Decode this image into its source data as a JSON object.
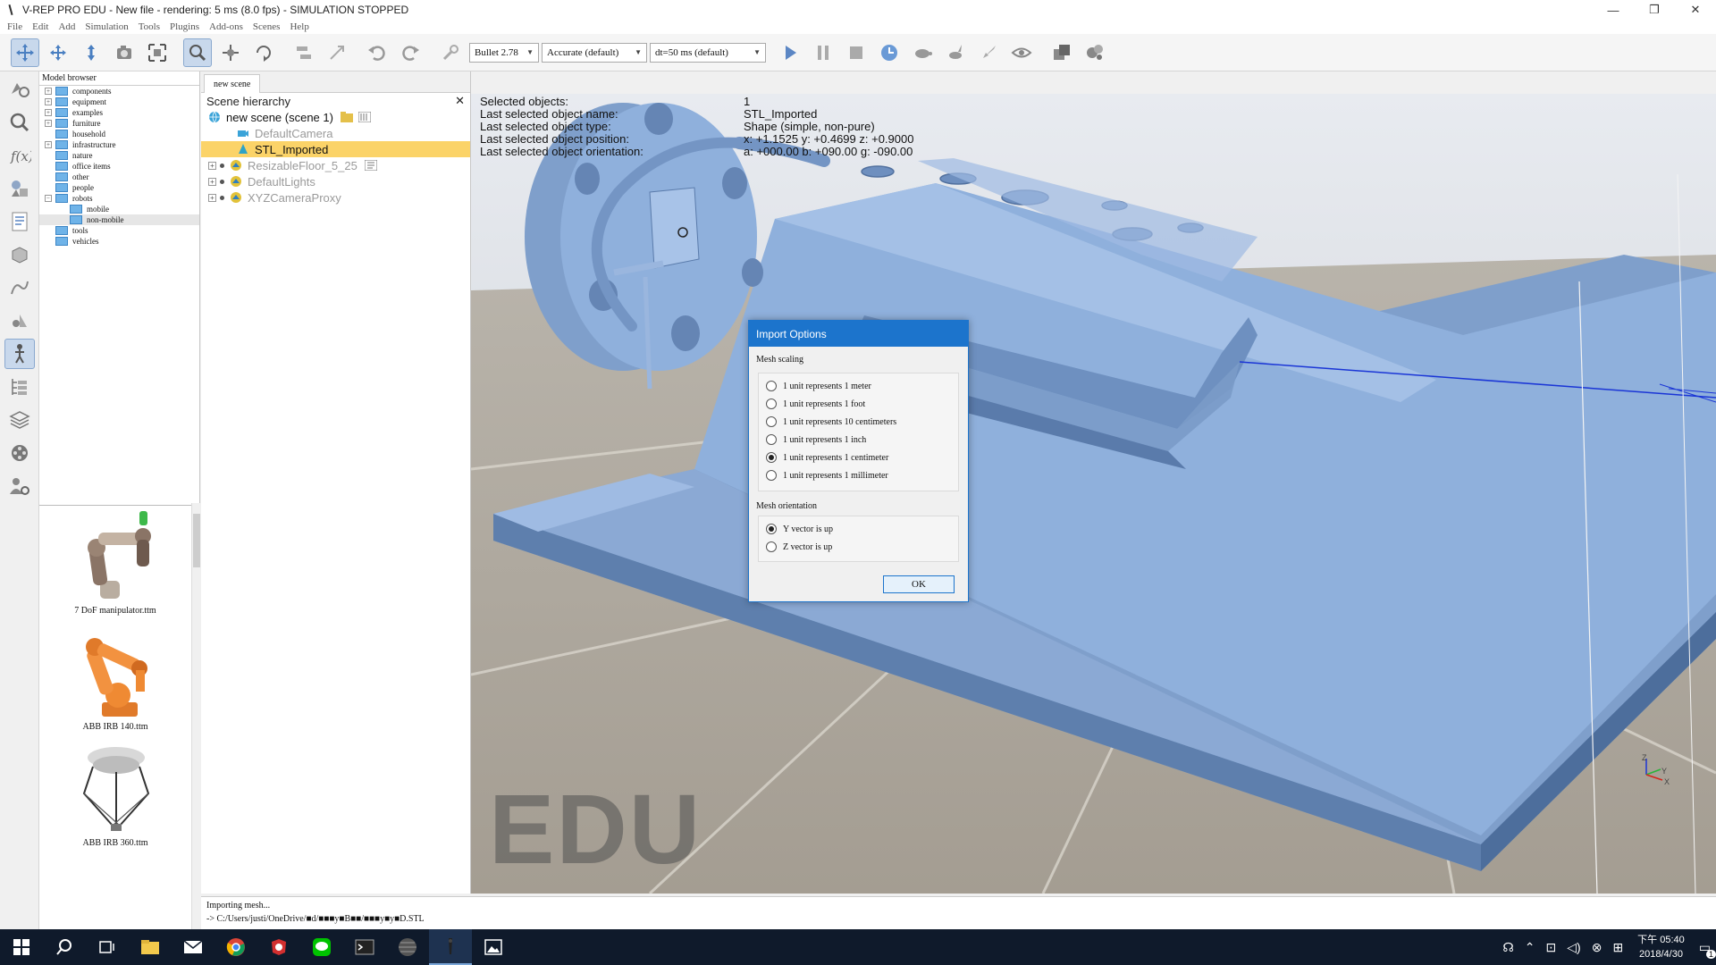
{
  "window": {
    "title": "V-REP PRO EDU - New file - rendering: 5 ms (8.0 fps) - SIMULATION STOPPED",
    "minimize": "—",
    "restore": "❐",
    "close": "✕"
  },
  "menu": [
    "File",
    "Edit",
    "Add",
    "Simulation",
    "Tools",
    "Plugins",
    "Add-ons",
    "Scenes",
    "Help"
  ],
  "toolbar": {
    "engine": "Bullet 2.78",
    "accuracy": "Accurate (default)",
    "timestep": "dt=50 ms (default)"
  },
  "model_browser": {
    "title": "Model browser",
    "tree": [
      {
        "label": "components",
        "expander": "+",
        "depth": 0
      },
      {
        "label": "equipment",
        "expander": "+",
        "depth": 0
      },
      {
        "label": "examples",
        "expander": "+",
        "depth": 0
      },
      {
        "label": "furniture",
        "expander": "+",
        "depth": 0
      },
      {
        "label": "household",
        "expander": "",
        "depth": 0
      },
      {
        "label": "infrastructure",
        "expander": "+",
        "depth": 0
      },
      {
        "label": "nature",
        "expander": "",
        "depth": 0
      },
      {
        "label": "office items",
        "expander": "",
        "depth": 0
      },
      {
        "label": "other",
        "expander": "",
        "depth": 0
      },
      {
        "label": "people",
        "expander": "",
        "depth": 0
      },
      {
        "label": "robots",
        "expander": "−",
        "depth": 0
      },
      {
        "label": "mobile",
        "expander": "",
        "depth": 1
      },
      {
        "label": "non-mobile",
        "expander": "",
        "depth": 1,
        "selected": true
      },
      {
        "label": "tools",
        "expander": "",
        "depth": 0
      },
      {
        "label": "vehicles",
        "expander": "",
        "depth": 0
      }
    ],
    "thumbnails": [
      {
        "label": "7 DoF manipulator.ttm"
      },
      {
        "label": "ABB IRB 140.ttm"
      },
      {
        "label": "ABB IRB 360.ttm"
      }
    ]
  },
  "scene": {
    "tab": "new scene",
    "hierarchy_title": "Scene hierarchy",
    "items": [
      {
        "label": "new scene (scene 1)",
        "kind": "root"
      },
      {
        "label": "DefaultCamera",
        "kind": "camera",
        "dim": true
      },
      {
        "label": "STL_Imported",
        "kind": "shape",
        "selected": true
      },
      {
        "label": "ResizableFloor_5_25",
        "kind": "floor",
        "dim": true
      },
      {
        "label": "DefaultLights",
        "kind": "lights",
        "dim": true
      },
      {
        "label": "XYZCameraProxy",
        "kind": "proxy",
        "dim": true
      }
    ]
  },
  "viewport": {
    "info": [
      {
        "k": "Selected objects:",
        "v": "1"
      },
      {
        "k": "Last selected object name:",
        "v": "STL_Imported"
      },
      {
        "k": "Last selected object type:",
        "v": "Shape (simple, non-pure)"
      },
      {
        "k": "Last selected object position:",
        "v": "x: +1.1525    y: +0.4699    z: +0.9000"
      },
      {
        "k": "Last selected object orientation:",
        "v": "a: +000.00    b: +090.00    g: -090.00"
      }
    ],
    "watermark": "EDU",
    "axis_labels": {
      "z": "Z",
      "y": "Y",
      "x": "X"
    }
  },
  "dialog": {
    "title": "Import Options",
    "scaling_label": "Mesh scaling",
    "scaling_options": [
      {
        "label": "1 unit represents 1 meter",
        "checked": false
      },
      {
        "label": "1 unit represents 1 foot",
        "checked": false
      },
      {
        "label": "1 unit represents 10 centimeters",
        "checked": false
      },
      {
        "label": "1 unit represents 1 inch",
        "checked": false
      },
      {
        "label": "1 unit represents 1 centimeter",
        "checked": true
      },
      {
        "label": "1 unit represents 1 millimeter",
        "checked": false
      }
    ],
    "orientation_label": "Mesh orientation",
    "orientation_options": [
      {
        "label": "Y vector is up",
        "checked": true
      },
      {
        "label": "Z vector is up",
        "checked": false
      }
    ],
    "ok": "OK"
  },
  "status": {
    "line1": "Importing mesh...",
    "line2": "-> C:/Users/justi/OneDrive/■d/■■■y■B■■/■■■y■y■D.STL"
  },
  "taskbar": {
    "clock_time": "下午 05:40",
    "clock_date": "2018/4/30",
    "notifications": "1"
  },
  "colors": {
    "accent": "#1c74cc",
    "selection": "#fbd368",
    "model": "#8fb0dc"
  }
}
